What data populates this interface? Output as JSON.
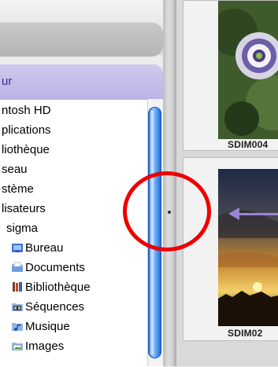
{
  "sidebar": {
    "section_title": "ur",
    "items": [
      {
        "label": "ntosh HD",
        "icon": "none"
      },
      {
        "label": "plications",
        "icon": "none"
      },
      {
        "label": "liothèque",
        "icon": "none"
      },
      {
        "label": "seau",
        "icon": "none"
      },
      {
        "label": "stème",
        "icon": "none"
      },
      {
        "label": "lisateurs",
        "icon": "none"
      },
      {
        "label": "sigma",
        "icon": "none"
      },
      {
        "label": "Bureau",
        "icon": "desktop-folder-icon"
      },
      {
        "label": "Documents",
        "icon": "documents-folder-icon"
      },
      {
        "label": "Bibliothèque",
        "icon": "library-folder-icon"
      },
      {
        "label": "Séquences",
        "icon": "movies-folder-icon"
      },
      {
        "label": "Musique",
        "icon": "music-folder-icon"
      },
      {
        "label": "Images",
        "icon": "pictures-folder-icon"
      }
    ]
  },
  "thumbnails": [
    {
      "label": "SDIM004",
      "subject": "passionflower"
    },
    {
      "label": "SDIM02",
      "subject": "sunset"
    }
  ],
  "colors": {
    "accent_header": "#bcb4e6",
    "scroll_thumb": "#4a90ee",
    "annotation_circle": "#ee0000",
    "annotation_arrow": "#9a83d6"
  }
}
